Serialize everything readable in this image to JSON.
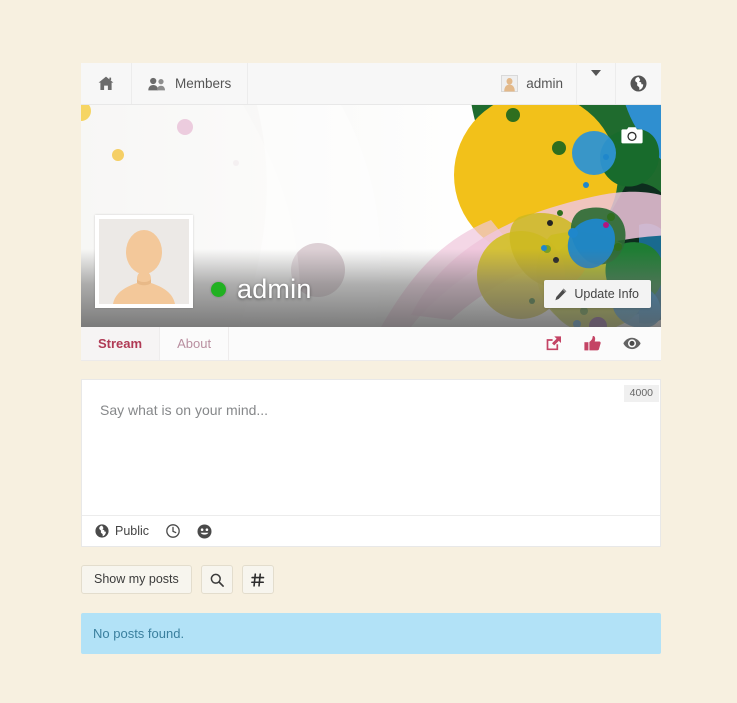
{
  "theme": {
    "page_background": "#f7f0e0",
    "accent": "#b03a55",
    "online": "#21b121",
    "alert_bg": "#b2e2f7",
    "alert_text": "#3a7f9e"
  },
  "navbar": {
    "home": {
      "label": "",
      "icon": "home-icon"
    },
    "members": {
      "label": "Members",
      "icon": "users-icon"
    },
    "account": {
      "label": "admin",
      "icon": "user-avatar-icon"
    },
    "dropdown": {
      "label": "",
      "icon": "chevron-down-icon"
    },
    "language": {
      "label": "",
      "icon": "globe-icon"
    }
  },
  "cover": {
    "camera_button": {
      "icon": "camera-icon"
    },
    "profile_image_alt": "default-profile-avatar",
    "user_name": "admin",
    "online_status": "online",
    "update_info": {
      "label": "Update Info",
      "icon": "pencil-icon"
    }
  },
  "tabs": [
    {
      "label": "Stream",
      "active": true
    },
    {
      "label": "About",
      "active": false
    }
  ],
  "tab_actions": [
    {
      "name": "share-icon"
    },
    {
      "name": "thumbs-up-icon"
    },
    {
      "name": "eye-icon"
    }
  ],
  "composer": {
    "placeholder": "Say what is on your mind...",
    "value": "",
    "char_count": "4000",
    "visibility": {
      "label": "Public",
      "icon": "globe-icon"
    },
    "schedule": {
      "icon": "clock-icon"
    },
    "emoji": {
      "icon": "smiley-icon"
    }
  },
  "filters": {
    "show_my_posts": "Show my posts",
    "search": {
      "icon": "search-icon"
    },
    "hashtag": {
      "icon": "hashtag-icon"
    }
  },
  "stream": {
    "empty_message": "No posts found."
  }
}
